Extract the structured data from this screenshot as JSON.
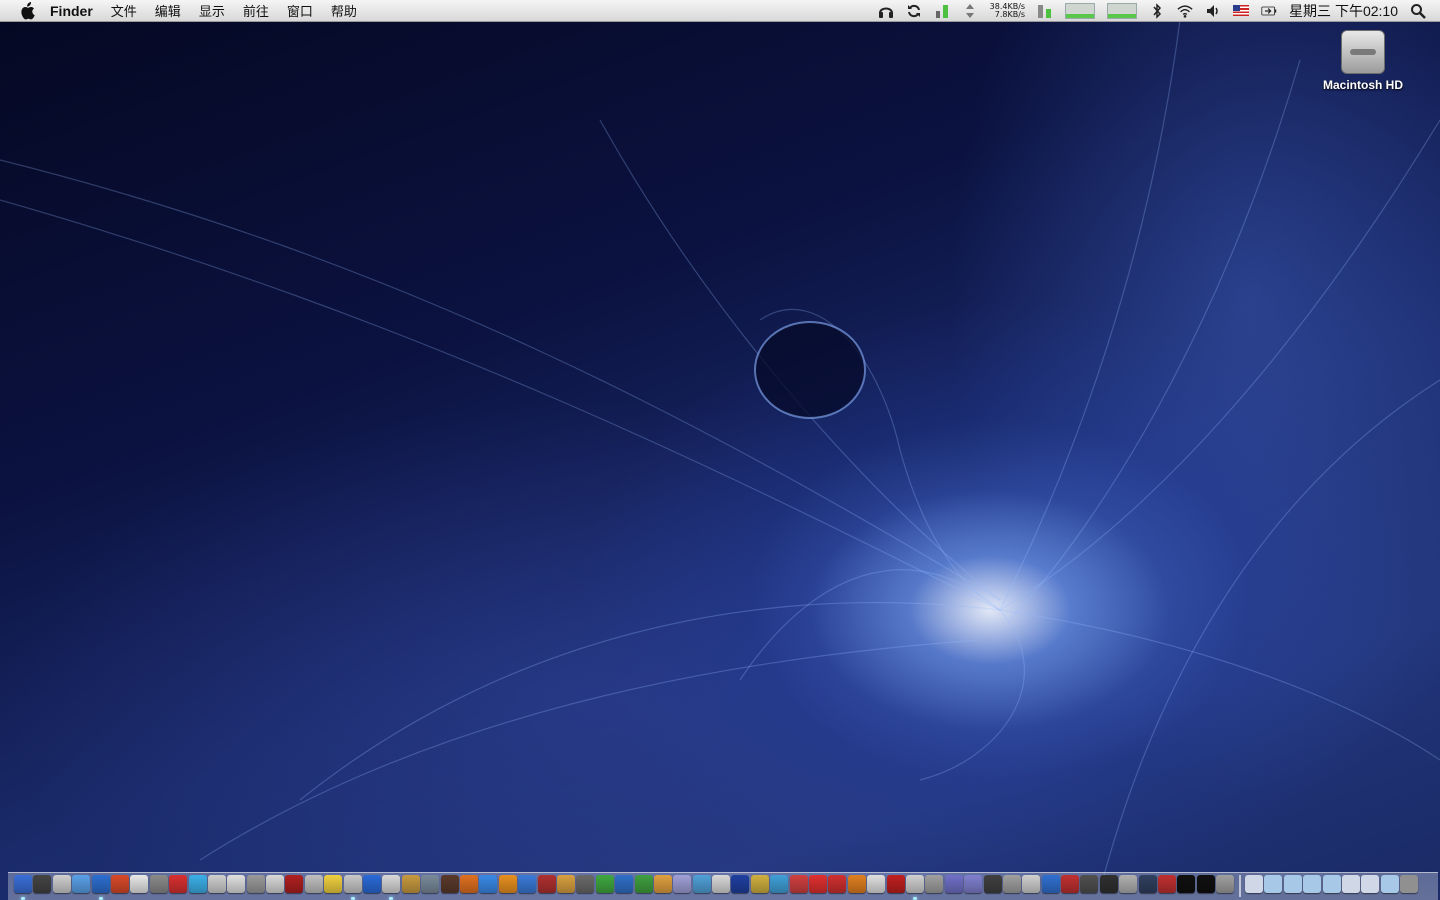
{
  "menubar": {
    "apple_icon": "apple-logo",
    "app_name": "Finder",
    "menus": [
      "文件",
      "编辑",
      "显示",
      "前往",
      "窗口",
      "帮助"
    ],
    "status": {
      "net_up": "38.4KB/s",
      "net_down": "7.8KB/s",
      "clock": "星期三 下午02:10",
      "icons": [
        "headphones-icon",
        "sync-icon",
        "battery-meter-icon",
        "network-arrows-icon",
        "memory-meter-icon",
        "cpu-graph-icon",
        "net-graph-icon",
        "bluetooth-icon",
        "wifi-icon",
        "volume-icon",
        "us-flag-icon",
        "battery-icon",
        "spotlight-icon"
      ]
    }
  },
  "desktop": {
    "drive_label": "Macintosh HD"
  },
  "dock": {
    "item_colors": [
      "#3a6fd8",
      "#444",
      "#cfcfcf",
      "#5aa0e8",
      "#2d6fd0",
      "#d84a2a",
      "#e8e8e8",
      "#8a8a8a",
      "#d83030",
      "#3cb0e8",
      "#cfcfcf",
      "#e0e0e0",
      "#9a9a9a",
      "#d8d8d8",
      "#b02020",
      "#c0c0c0",
      "#f0d040",
      "#c8c8c8",
      "#2a6ad8",
      "#d8d8d8",
      "#c89a40",
      "#7a8a9a",
      "#5a3a2a",
      "#e07020",
      "#3a8ae8",
      "#e89020",
      "#3a7ad8",
      "#b03030",
      "#d8a040",
      "#6a6a6a",
      "#40a840",
      "#3070c8",
      "#40a040",
      "#e0a040",
      "#a0a0d8",
      "#50a0d8",
      "#d8d8d8",
      "#2040a0",
      "#d0b040",
      "#40a0d8",
      "#d04040",
      "#e03030",
      "#d03030",
      "#e08020",
      "#e0e0e0",
      "#c02020",
      "#d0d0d0",
      "#a0a0a0",
      "#7070c8",
      "#8080d0",
      "#404040",
      "#a0a0a0",
      "#d0d0d0",
      "#3070d0",
      "#c03030",
      "#505050",
      "#303030",
      "#b0b0b0",
      "#304060",
      "#c03030",
      "#101010",
      "#101010",
      "#a0a0a0"
    ],
    "stack_colors": [
      "#d0d8e8",
      "#a8c8e8",
      "#a8c8e8",
      "#a8c8e8",
      "#a8c8e8",
      "#d0d8e8",
      "#d0d8e8",
      "#a8c8e8",
      "#909090"
    ]
  }
}
